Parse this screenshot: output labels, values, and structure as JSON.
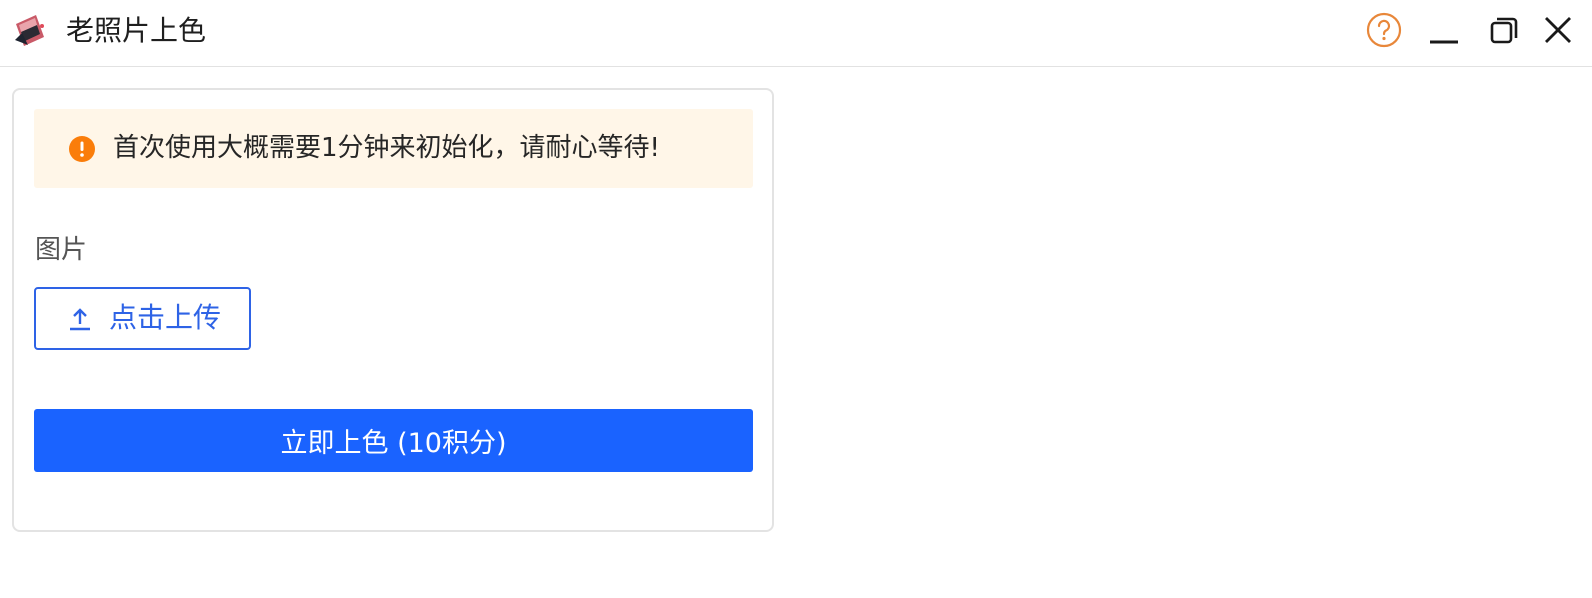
{
  "window": {
    "title": "老照片上色",
    "logo_icon": "photo-app-logo-icon",
    "controls": {
      "help_icon": "help-icon",
      "minimize_icon": "minimize-icon",
      "maximize_icon": "restore-icon",
      "close_icon": "close-icon"
    }
  },
  "colors": {
    "accent": "#1a63ff",
    "upload_border": "#2e63e6",
    "warning": "#fa7d0a",
    "alert_bg": "#fff6e8",
    "help": "#e8873a"
  },
  "main": {
    "alert": {
      "icon": "warning-icon",
      "text": "首次使用大概需要1分钟来初始化，请耐心等待!"
    },
    "image_field": {
      "label": "图片",
      "upload_icon": "upload-icon",
      "upload_label": "点击上传"
    },
    "submit": {
      "label": "立即上色 (10积分)"
    }
  }
}
